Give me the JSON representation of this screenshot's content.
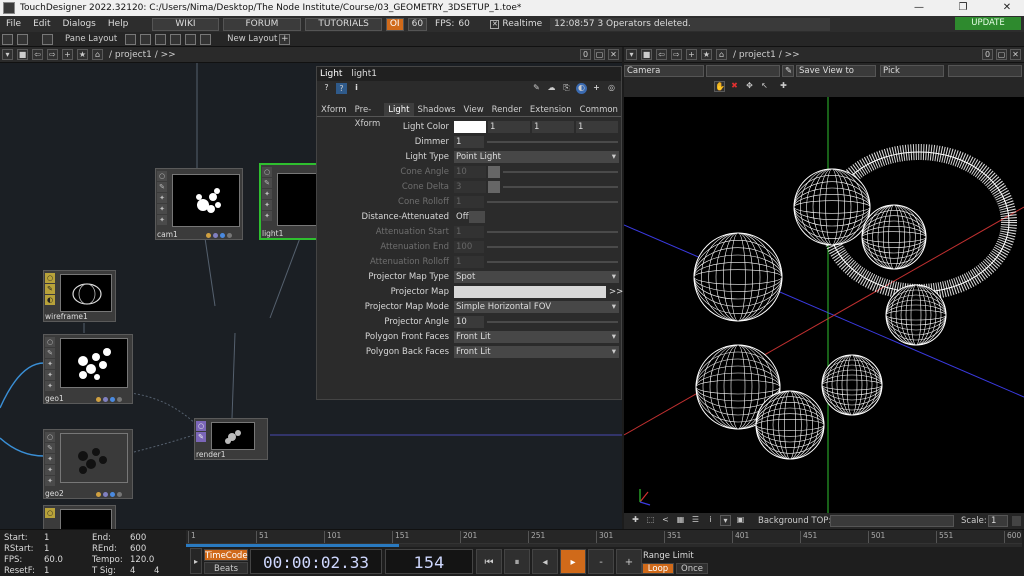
{
  "window": {
    "title": "TouchDesigner 2022.32120: C:/Users/Nima/Desktop/The Node Institute/Course/03_GEOMETRY_3DSETUP_1.toe*",
    "minimize": "—",
    "maximize": "❐",
    "close": "✕"
  },
  "menubar": {
    "items": [
      "File",
      "Edit",
      "Dialogs",
      "Help"
    ],
    "wiki": "WIKI",
    "forum": "FORUM",
    "tutorials": "TUTORIALS",
    "oi": "OI",
    "fps_target": "60",
    "fps_label": "FPS:",
    "fps_value": "60",
    "realtime": "Realtime",
    "status": "12:08:57 3 Operators deleted.",
    "update": "UPDATE"
  },
  "toolbar": {
    "pane_layout": "Pane Layout",
    "new_layout": "New Layout",
    "plus": "+"
  },
  "network_header": {
    "path": "/ project1 / >>",
    "count": "0"
  },
  "nodes": {
    "cam1": "cam1",
    "light1": "light1",
    "wireframe1": "wireframe1",
    "geo1": "geo1",
    "render1": "render1",
    "geo2": "geo2"
  },
  "params": {
    "type": "Light",
    "name": "light1",
    "tabs": [
      "Xform",
      "Pre-Xform",
      "Light",
      "Shadows",
      "View",
      "Render",
      "Extension",
      "Common",
      "»"
    ],
    "active_tab": "Light",
    "rows": [
      {
        "label": "Light Color",
        "v1": "",
        "v2": "1",
        "v3": "1",
        "v4": "1",
        "disabled": false
      },
      {
        "label": "Dimmer",
        "v1": "1",
        "disabled": false
      },
      {
        "label": "Light Type",
        "menu": "Point Light",
        "disabled": false
      },
      {
        "label": "Cone Angle",
        "v1": "10",
        "disabled": true
      },
      {
        "label": "Cone Delta",
        "v1": "3",
        "disabled": true
      },
      {
        "label": "Cone Rolloff",
        "v1": "1",
        "disabled": true
      },
      {
        "label": "Distance-Attenuated",
        "toggle": "Off",
        "disabled": false
      },
      {
        "label": "Attenuation Start",
        "v1": "1",
        "disabled": true
      },
      {
        "label": "Attenuation End",
        "v1": "100",
        "disabled": true
      },
      {
        "label": "Attenuation Rolloff",
        "v1": "1",
        "disabled": true
      },
      {
        "label": "Projector Map Type",
        "menu": "Spot",
        "disabled": false
      },
      {
        "label": "Projector Map",
        "field": "",
        "more": ">>",
        "disabled": false
      },
      {
        "label": "Projector Map Mode",
        "menu": "Simple Horizontal FOV",
        "disabled": false
      },
      {
        "label": "Projector Angle",
        "v1": "10",
        "disabled": false
      },
      {
        "label": "Polygon Front Faces",
        "menu": "Front Lit",
        "disabled": false
      },
      {
        "label": "Polygon Back Faces",
        "menu": "Front Lit",
        "disabled": false
      }
    ]
  },
  "viewer_header": {
    "path": "/ project1 / >>",
    "count": "0",
    "camera_menu": "Camera",
    "save_view": "Save View to",
    "pick": "Pick"
  },
  "viewer_footer": {
    "background_label": "Background TOP:",
    "scale_label": "Scale:",
    "scale_value": "1"
  },
  "timeline": {
    "start_label": "Start:",
    "start": "1",
    "rstart_label": "RStart:",
    "rstart": "1",
    "fps_label": "FPS:",
    "fps": "60.0",
    "resetf_label": "ResetF:",
    "resetf": "1",
    "end_label": "End:",
    "end": "600",
    "rend_label": "REnd:",
    "rend": "600",
    "tempo_label": "Tempo:",
    "tempo": "120.0",
    "tsig_label": "T Sig:",
    "tsig1": "4",
    "tsig2": "4",
    "timecode_btn": "TimeCode",
    "beats_btn": "Beats",
    "timecode": "00:00:02.33",
    "frame": "154",
    "range_limit": "Range Limit",
    "loop": "Loop",
    "once": "Once",
    "ruler": [
      "1",
      "51",
      "101",
      "151",
      "201",
      "251",
      "301",
      "351",
      "401",
      "451",
      "501",
      "551",
      "600"
    ],
    "progress": 0.255
  },
  "colors": {
    "accent_orange": "#d06a1a",
    "update_green": "#2e8a2e",
    "light_node_border": "#2fbf2f",
    "axis_red": "#c03030",
    "axis_blue": "#3a3ae0",
    "axis_green": "#30c030"
  }
}
